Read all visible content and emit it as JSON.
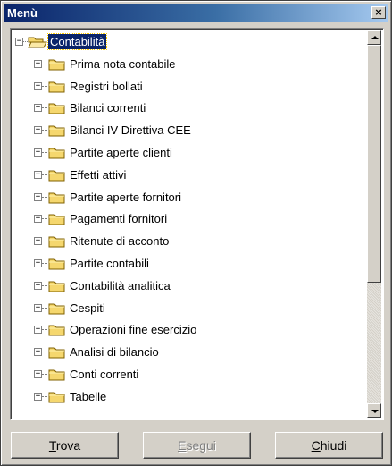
{
  "window": {
    "title": "Menù",
    "close_glyph": "×"
  },
  "tree": {
    "root": {
      "label": "Contabilità",
      "expander": "−",
      "icon": "folder-open-icon"
    },
    "children": [
      {
        "label": "Prima nota contabile"
      },
      {
        "label": "Registri bollati"
      },
      {
        "label": "Bilanci correnti"
      },
      {
        "label": "Bilanci IV Direttiva CEE"
      },
      {
        "label": "Partite aperte clienti"
      },
      {
        "label": "Effetti attivi"
      },
      {
        "label": "Partite aperte fornitori"
      },
      {
        "label": "Pagamenti fornitori"
      },
      {
        "label": "Ritenute di acconto"
      },
      {
        "label": "Partite contabili"
      },
      {
        "label": "Contabilità analitica"
      },
      {
        "label": "Cespiti"
      },
      {
        "label": "Operazioni fine esercizio"
      },
      {
        "label": "Analisi di bilancio"
      },
      {
        "label": "Conti correnti"
      },
      {
        "label": "Tabelle"
      }
    ],
    "child_expander": "+"
  },
  "buttons": {
    "trova": {
      "accel": "T",
      "rest": "rova"
    },
    "esegui": {
      "accel": "E",
      "rest": "segui",
      "disabled": true
    },
    "chiudi": {
      "accel": "C",
      "rest": "hiudi"
    }
  },
  "colors": {
    "selection": "#0a246a",
    "folder": "#f5d76e",
    "face": "#d4d0c8"
  }
}
